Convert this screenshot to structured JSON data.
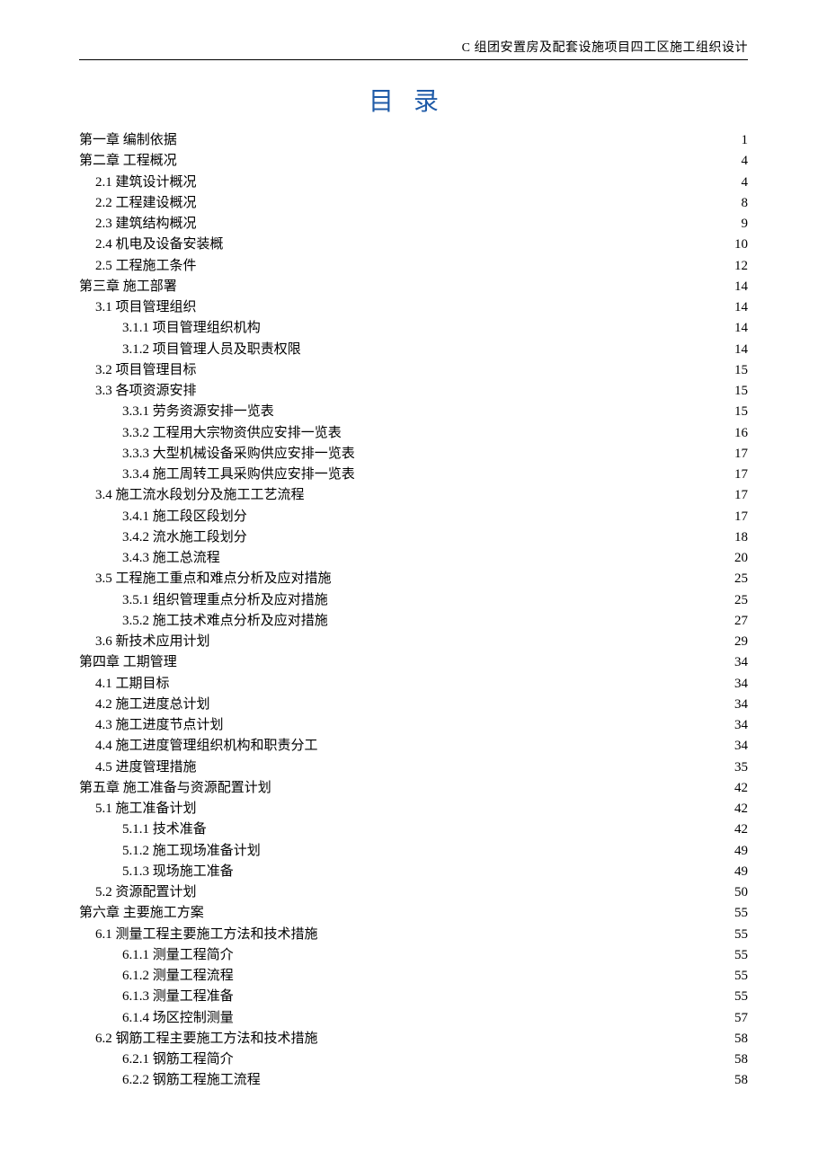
{
  "header": "C 组团安置房及配套设施项目四工区施工组织设计",
  "toc_title": "目录",
  "toc": [
    {
      "level": 0,
      "label": "第一章  编制依据",
      "page": "1"
    },
    {
      "level": 0,
      "label": "第二章 工程概况",
      "page": "4"
    },
    {
      "level": 1,
      "label": "2.1 建筑设计概况",
      "page": "4"
    },
    {
      "level": 1,
      "label": "2.2 工程建设概况",
      "page": "8"
    },
    {
      "level": 1,
      "label": "2.3 建筑结构概况",
      "page": "9"
    },
    {
      "level": 1,
      "label": "2.4 机电及设备安装概",
      "page": "10"
    },
    {
      "level": 1,
      "label": "2.5 工程施工条件",
      "page": "12"
    },
    {
      "level": 0,
      "label": "第三章 施工部署",
      "page": "14"
    },
    {
      "level": 1,
      "label": "3.1 项目管理组织",
      "page": "14"
    },
    {
      "level": 2,
      "label": "3.1.1 项目管理组织机构",
      "page": "14"
    },
    {
      "level": 2,
      "label": "3.1.2 项目管理人员及职责权限",
      "page": "14"
    },
    {
      "level": 1,
      "label": "3.2 项目管理目标",
      "page": "15"
    },
    {
      "level": 1,
      "label": "3.3 各项资源安排",
      "page": "15"
    },
    {
      "level": 2,
      "label": "3.3.1 劳务资源安排一览表",
      "page": "15"
    },
    {
      "level": 2,
      "label": "3.3.2 工程用大宗物资供应安排一览表",
      "page": "16"
    },
    {
      "level": 2,
      "label": "3.3.3 大型机械设备采购供应安排一览表",
      "page": "17"
    },
    {
      "level": 2,
      "label": "3.3.4 施工周转工具采购供应安排一览表",
      "page": "17"
    },
    {
      "level": 1,
      "label": "3.4 施工流水段划分及施工工艺流程",
      "page": "17"
    },
    {
      "level": 2,
      "label": "3.4.1 施工段区段划分",
      "page": "17"
    },
    {
      "level": 2,
      "label": "3.4.2 流水施工段划分",
      "page": "18"
    },
    {
      "level": 2,
      "label": "3.4.3 施工总流程",
      "page": "20"
    },
    {
      "level": 1,
      "label": "3.5 工程施工重点和难点分析及应对措施",
      "page": "25"
    },
    {
      "level": 2,
      "label": "3.5.1 组织管理重点分析及应对措施",
      "page": "25"
    },
    {
      "level": 2,
      "label": "3.5.2 施工技术难点分析及应对措施",
      "page": "27"
    },
    {
      "level": 1,
      "label": "3.6 新技术应用计划",
      "page": "29"
    },
    {
      "level": 0,
      "label": "第四章 工期管理",
      "page": "34"
    },
    {
      "level": 1,
      "label": "4.1 工期目标",
      "page": "34"
    },
    {
      "level": 1,
      "label": "4.2 施工进度总计划",
      "page": "34"
    },
    {
      "level": 1,
      "label": "4.3 施工进度节点计划",
      "page": "34"
    },
    {
      "level": 1,
      "label": "4.4 施工进度管理组织机构和职责分工",
      "page": "34"
    },
    {
      "level": 1,
      "label": "4.5 进度管理措施",
      "page": "35"
    },
    {
      "level": 0,
      "label": "第五章 施工准备与资源配置计划",
      "page": "42"
    },
    {
      "level": 1,
      "label": "5.1 施工准备计划",
      "page": "42"
    },
    {
      "level": 2,
      "label": "5.1.1 技术准备",
      "page": "42"
    },
    {
      "level": 2,
      "label": "5.1.2 施工现场准备计划",
      "page": "49"
    },
    {
      "level": 2,
      "label": "5.1.3 现场施工准备",
      "page": "49"
    },
    {
      "level": 1,
      "label": "5.2 资源配置计划",
      "page": "50"
    },
    {
      "level": 0,
      "label": "第六章 主要施工方案",
      "page": "55"
    },
    {
      "level": 1,
      "label": "6.1 测量工程主要施工方法和技术措施",
      "page": "55"
    },
    {
      "level": 2,
      "label": "6.1.1 测量工程简介",
      "page": "55"
    },
    {
      "level": 2,
      "label": "6.1.2 测量工程流程",
      "page": "55"
    },
    {
      "level": 2,
      "label": "6.1.3 测量工程准备",
      "page": "55"
    },
    {
      "level": 2,
      "label": "6.1.4 场区控制测量",
      "page": "57"
    },
    {
      "level": 1,
      "label": "6.2 钢筋工程主要施工方法和技术措施",
      "page": "58"
    },
    {
      "level": 2,
      "label": "6.2.1 钢筋工程简介",
      "page": "58"
    },
    {
      "level": 2,
      "label": "6.2.2 钢筋工程施工流程",
      "page": "58"
    }
  ]
}
